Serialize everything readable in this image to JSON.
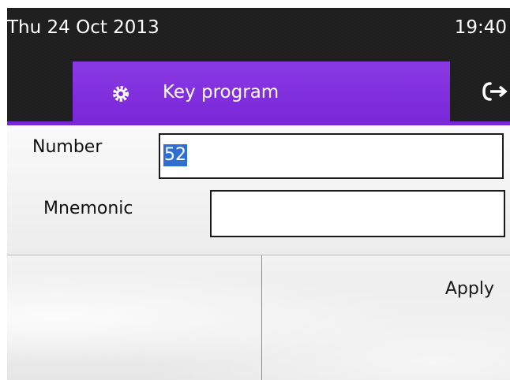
{
  "status": {
    "date": "Thu 24 Oct 2013",
    "time": "19:40"
  },
  "tabs": [
    {
      "label": "Key program",
      "icon": "gear-icon",
      "active": true
    },
    {
      "icon": "exit-icon"
    }
  ],
  "form": {
    "number": {
      "label": "Number",
      "value": "52"
    },
    "mnemonic": {
      "label": "Mnemonic",
      "value": ""
    }
  },
  "softkeys": {
    "left": "",
    "right": "Apply"
  },
  "colors": {
    "accent": "#7a27d8",
    "selection": "#2f6fd1",
    "background_dark": "#1e1e1e"
  }
}
